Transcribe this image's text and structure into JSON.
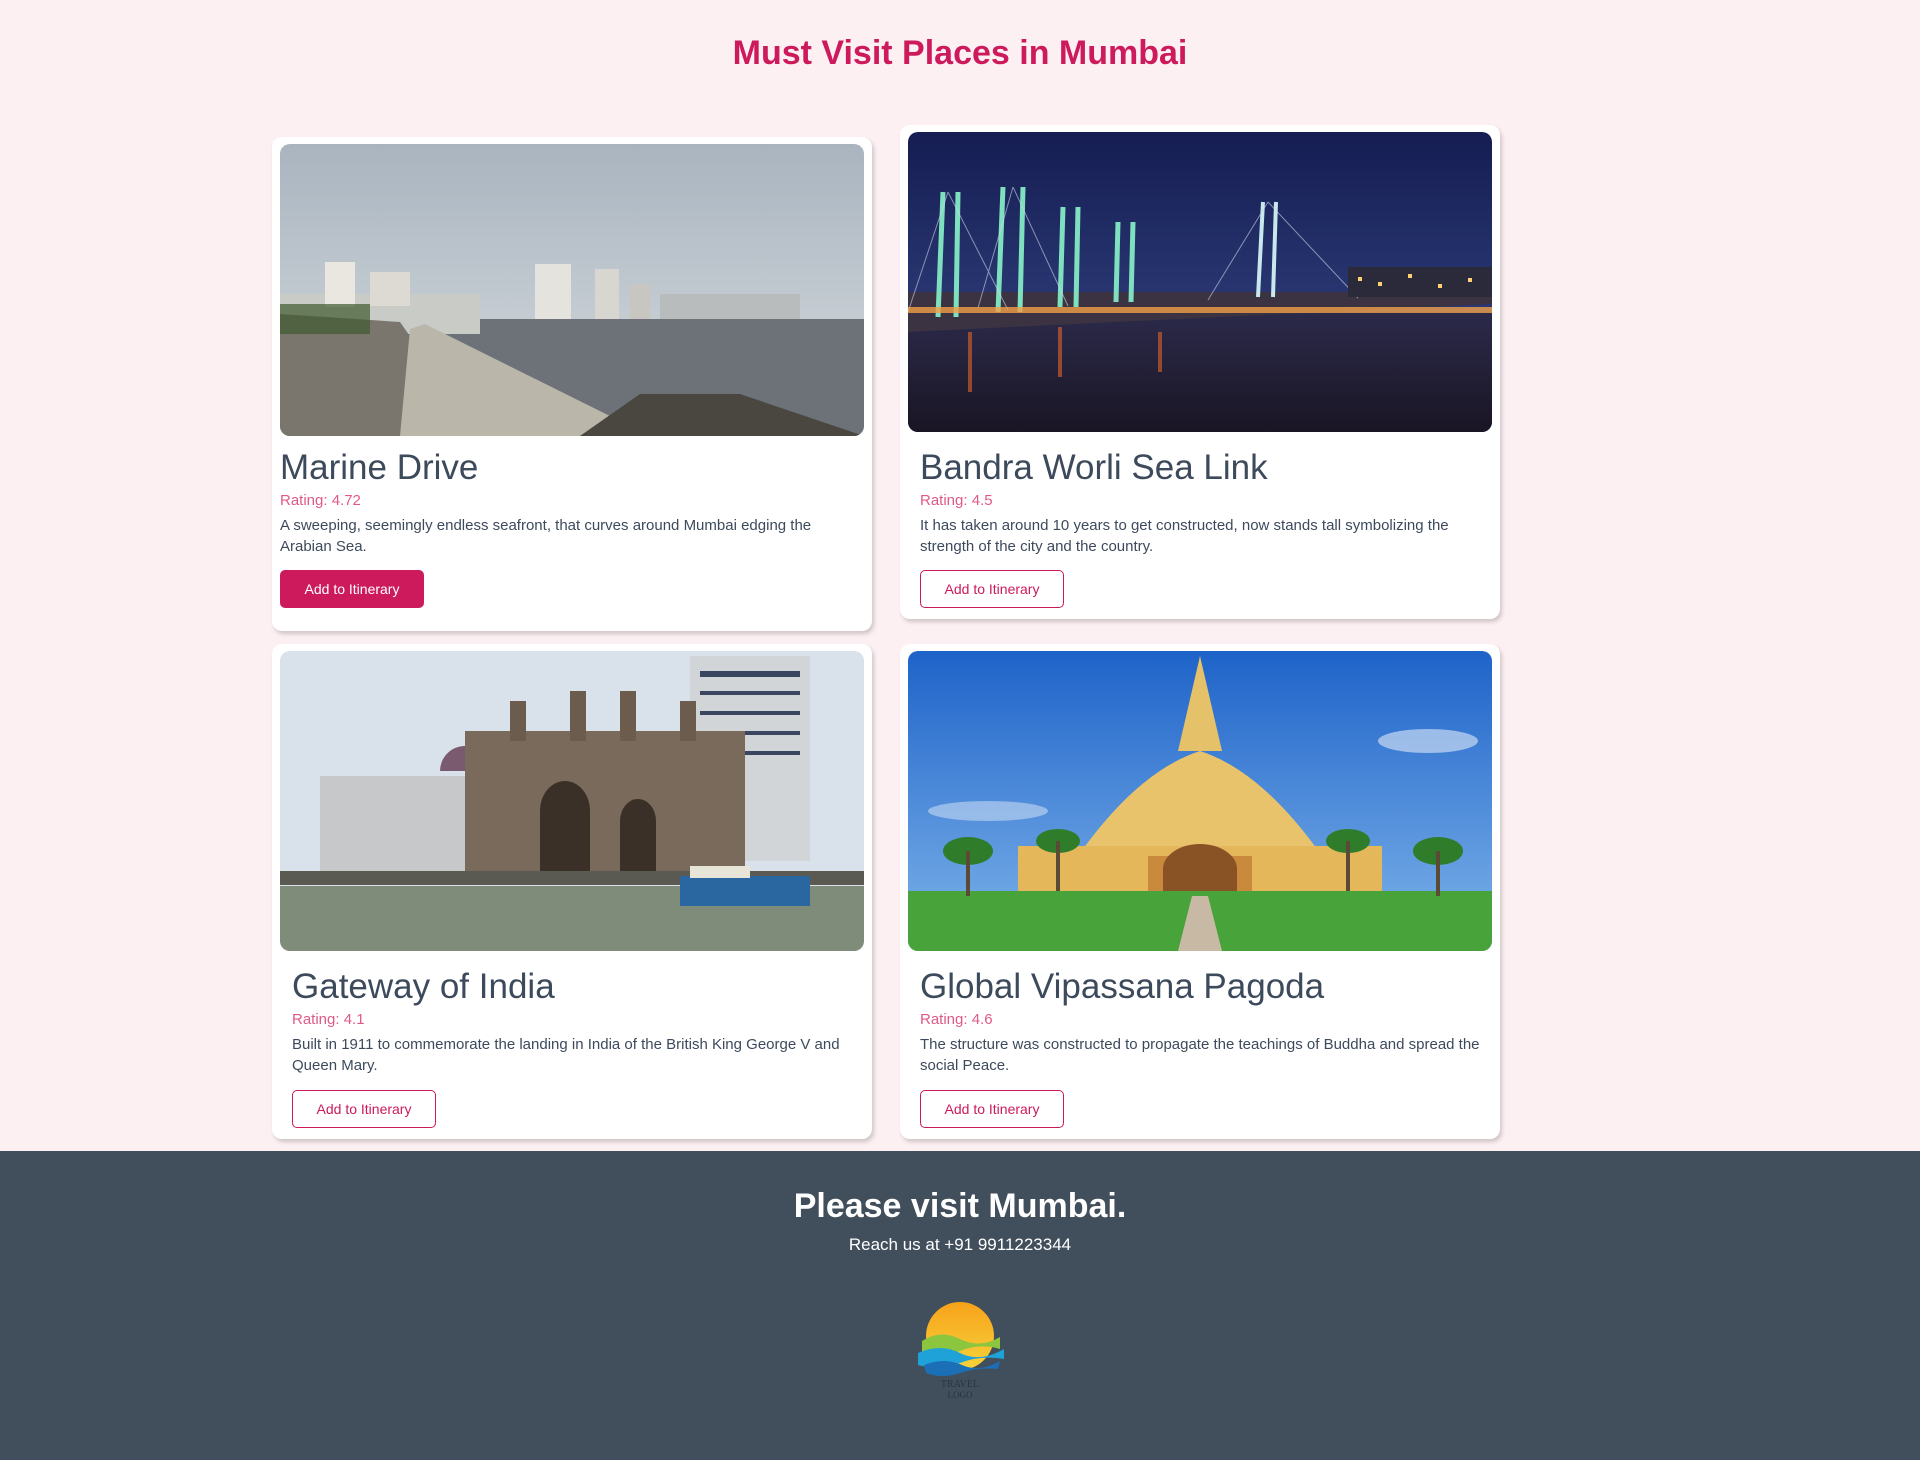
{
  "page": {
    "title": "Must Visit Places in Mumbai"
  },
  "places": [
    {
      "name": "Marine Drive",
      "rating": "Rating: 4.72",
      "description": "A sweeping, seemingly endless seafront, that curves around Mumbai edging the Arabian Sea.",
      "button_label": "Add to Itinerary",
      "button_state": "active",
      "image": "seafront-promenade-photo"
    },
    {
      "name": "Bandra Worli Sea Link",
      "rating": "Rating: 4.5",
      "description": "It has taken around 10 years to get constructed, now stands tall symbolizing the strength of the city and the country.",
      "button_label": "Add to Itinerary",
      "button_state": "default",
      "image": "cable-stayed-bridge-night-photo"
    },
    {
      "name": "Gateway of India",
      "rating": "Rating: 4.1",
      "description": "Built in 1911 to commemorate the landing in India of the British King George V and Queen Mary.",
      "button_label": "Add to Itinerary",
      "button_state": "default",
      "image": "gateway-monument-photo"
    },
    {
      "name": "Global Vipassana Pagoda",
      "rating": "Rating: 4.6",
      "description": "The structure was constructed to propagate the teachings of Buddha and spread the social Peace.",
      "button_label": "Add to Itinerary",
      "button_state": "default",
      "image": "golden-pagoda-photo"
    }
  ],
  "footer": {
    "heading": "Please visit Mumbai.",
    "contact": "Reach us at +91 9911223344",
    "logo_text": "TRAVEL LOGO",
    "logo": "sun-over-waves-logo"
  },
  "colors": {
    "accent": "#cc1a5c",
    "rating": "#e05a88",
    "background": "#fdf0f3",
    "footer": "#414e5c",
    "text": "#3d4a5c"
  }
}
